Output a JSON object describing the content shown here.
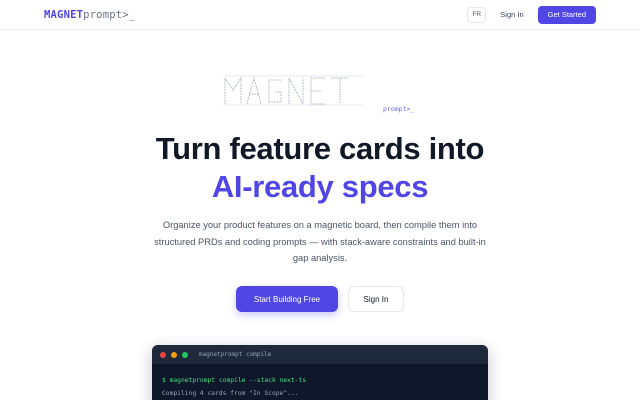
{
  "header": {
    "logo_primary": "MAGNET",
    "logo_secondary": "prompt>_",
    "lang": "FR",
    "signin": "Sign In",
    "get_started": "Get Started"
  },
  "hero": {
    "ascii_sub": "prompt>_",
    "title_line1": "Turn feature cards into",
    "title_line2": "AI-ready specs",
    "subtitle": "Organize your product features on a magnetic board, then compile them into structured PRDs and coding prompts — with stack-aware constraints and built-in gap analysis.",
    "cta_primary": "Start Building Free",
    "cta_secondary": "Sign In"
  },
  "terminal": {
    "title": "magnetprompt compile",
    "command": "$ magnetprompt compile --stack next-ts",
    "output": "Compiling 4 cards from \"In Scope\"..."
  },
  "colors": {
    "brand": "#4f46e5",
    "terminal_bg": "#0f172a",
    "terminal_cmd": "#4ade80"
  }
}
